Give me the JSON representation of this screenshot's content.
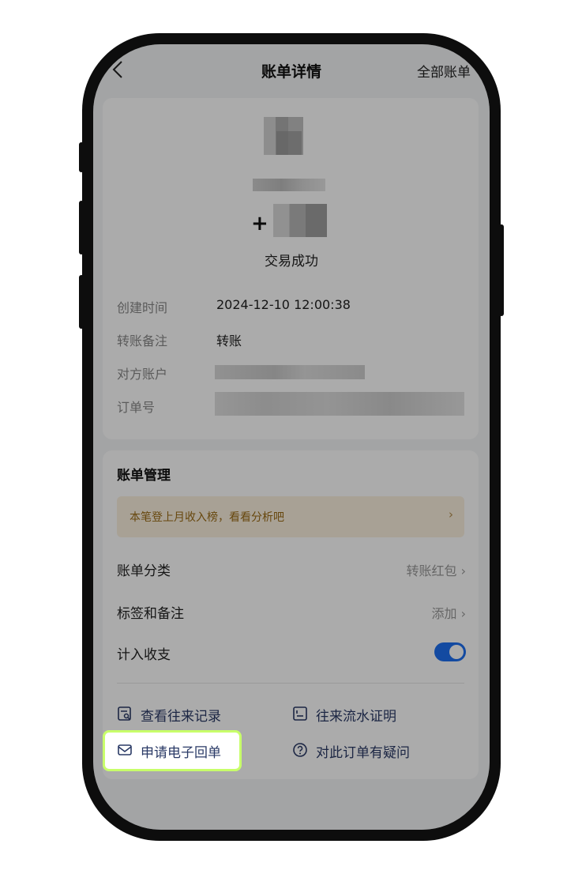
{
  "nav": {
    "title": "账单详情",
    "right_action": "全部账单"
  },
  "transaction": {
    "amount_sign": "+",
    "status": "交易成功"
  },
  "details": [
    {
      "label": "创建时间",
      "value": "2024-12-10 12:00:38"
    },
    {
      "label": "转账备注",
      "value": "转账"
    },
    {
      "label": "对方账户",
      "value": ""
    },
    {
      "label": "订单号",
      "value": ""
    }
  ],
  "management": {
    "title": "账单管理",
    "banner_text": "本笔登上月收入榜，看看分析吧",
    "banner_arrow": "›",
    "rows": [
      {
        "label": "账单分类",
        "value": "转账红包 ›"
      },
      {
        "label": "标签和备注",
        "value": "添加 ›"
      },
      {
        "label": "计入收支",
        "toggle_on": true
      }
    ]
  },
  "links": [
    {
      "label": "查看往来记录",
      "icon": "record-search-icon"
    },
    {
      "label": "往来流水证明",
      "icon": "document-icon"
    },
    {
      "label": "申请电子回单",
      "icon": "mail-icon"
    },
    {
      "label": "对此订单有疑问",
      "icon": "question-icon"
    }
  ],
  "colors": {
    "accent": "#1d6ff0",
    "highlight": "#c8ff6a",
    "banner_bg": "#fbf1df",
    "banner_text": "#9a6a14"
  }
}
